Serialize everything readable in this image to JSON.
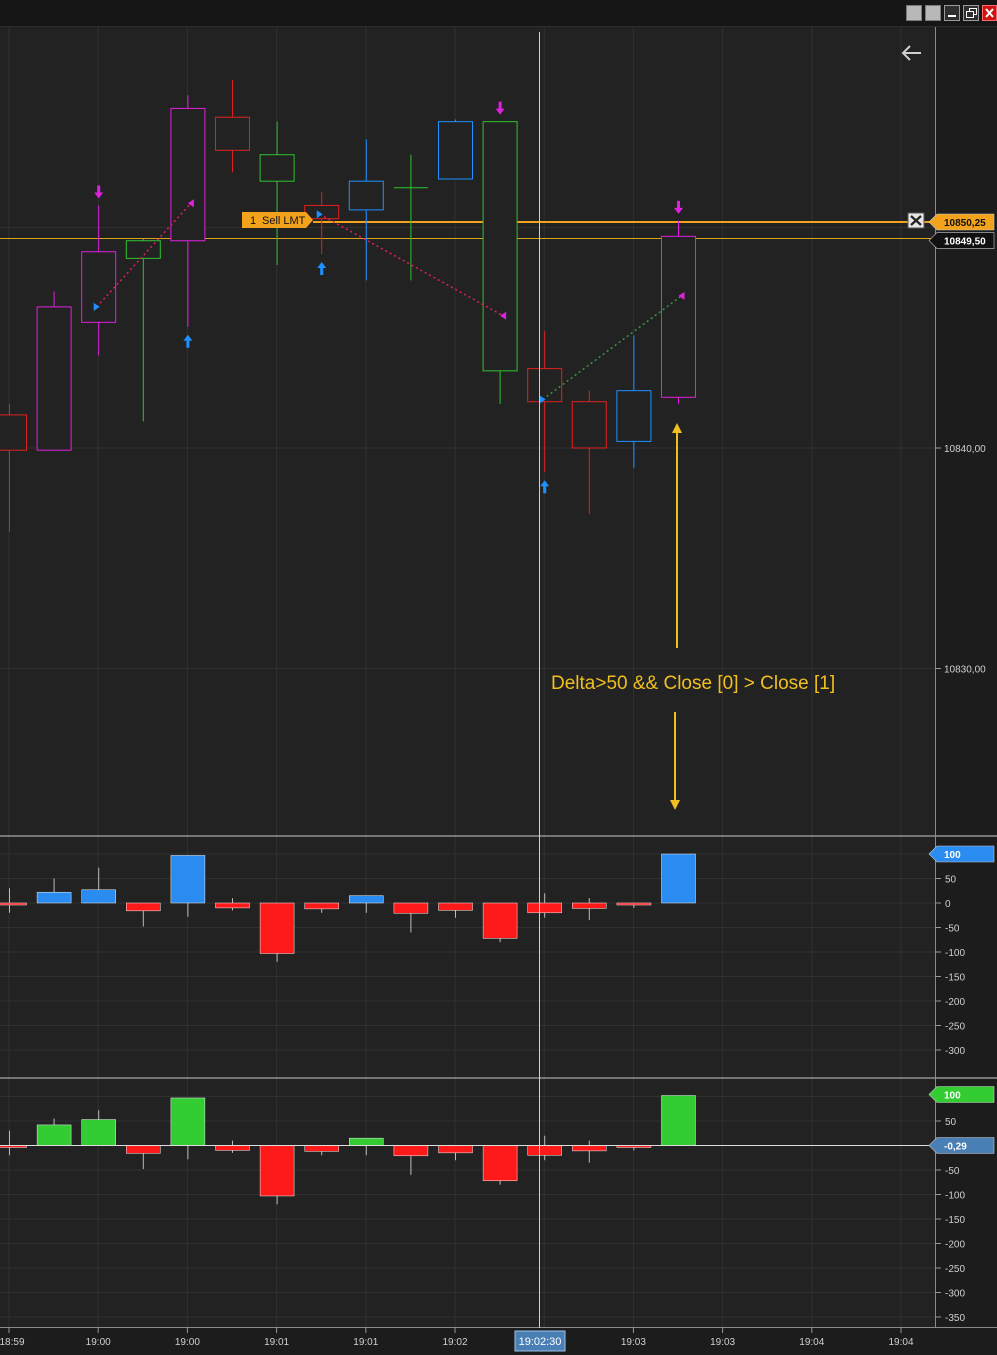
{
  "window_controls": [
    "restore-box-icon",
    "maximize-box-icon",
    "minimize-icon",
    "restore-icon",
    "close-icon"
  ],
  "colors": {
    "background": "#222222",
    "grid": "#303030",
    "up_candle": "#1e90ff",
    "down_candle": "#e02020",
    "doji_green": "#2ec32e",
    "magenta": "#e020e0",
    "order_line": "#f3a21c",
    "price_line": "#d9a41c",
    "annotation": "#f0c020",
    "delta_up": "#2a8cf0",
    "delta_down": "#ff1a1a",
    "cum_up": "#33cc33"
  },
  "order": {
    "qty": "1",
    "label": "Sell LMT",
    "price": 10850.25
  },
  "price_axis": {
    "ticks": [
      "10840,00",
      "10830,00"
    ],
    "order_price_label": "10850,25",
    "last_price_label": "10849,50"
  },
  "annotation": {
    "text": "Delta>50 && Close [0] > Close [1]"
  },
  "time_axis": {
    "labels": [
      "18:59",
      "19:00",
      "19:00",
      "19:01",
      "19:01",
      "19:02",
      "19:02:30",
      "19:03",
      "19:03",
      "19:04",
      "19:04"
    ],
    "crosshair_label": "19:02:30"
  },
  "chart_data": [
    {
      "type": "candlestick",
      "title": "",
      "ylim": [
        10822.5,
        10859
      ],
      "x_labels": [
        "18:59",
        "19:00",
        "19:00",
        "19:01",
        "19:01",
        "19:02",
        "19:02:30",
        "19:03",
        "19:03",
        "19:04",
        "19:04"
      ],
      "candles": [
        {
          "o": 10841.5,
          "h": 10842.0,
          "l": 10836.2,
          "c": 10839.9,
          "color": "red"
        },
        {
          "o": 10839.9,
          "h": 10847.1,
          "l": 10839.9,
          "c": 10846.4,
          "color": "magenta"
        },
        {
          "o": 10845.7,
          "h": 10851.0,
          "l": 10844.2,
          "c": 10848.9,
          "color": "magenta"
        },
        {
          "o": 10848.6,
          "h": 10849.5,
          "l": 10841.2,
          "c": 10849.4,
          "color": "green"
        },
        {
          "o": 10849.4,
          "h": 10856.0,
          "l": 10845.5,
          "c": 10855.4,
          "color": "magenta"
        },
        {
          "o": 10855.0,
          "h": 10856.7,
          "l": 10852.5,
          "c": 10853.5,
          "color": "red"
        },
        {
          "o": 10853.3,
          "h": 10854.8,
          "l": 10848.3,
          "c": 10852.1,
          "color": "green"
        },
        {
          "o": 10851.0,
          "h": 10851.6,
          "l": 10848.8,
          "c": 10850.4,
          "color": "red"
        },
        {
          "o": 10850.8,
          "h": 10854.0,
          "l": 10847.6,
          "c": 10852.1,
          "color": "blue"
        },
        {
          "o": 10851.8,
          "h": 10853.3,
          "l": 10847.6,
          "c": 10851.8,
          "color": "green"
        },
        {
          "o": 10852.2,
          "h": 10854.9,
          "l": 10852.2,
          "c": 10854.8,
          "color": "blue"
        },
        {
          "o": 10854.8,
          "h": 10854.8,
          "l": 10842.0,
          "c": 10843.5,
          "color": "green"
        },
        {
          "o": 10843.6,
          "h": 10845.3,
          "l": 10838.9,
          "c": 10842.1,
          "color": "red"
        },
        {
          "o": 10842.1,
          "h": 10842.6,
          "l": 10837.0,
          "c": 10840.0,
          "color": "red"
        },
        {
          "o": 10840.3,
          "h": 10845.1,
          "l": 10839.1,
          "c": 10842.6,
          "color": "blue"
        },
        {
          "o": 10842.3,
          "h": 10850.3,
          "l": 10842.0,
          "c": 10849.6,
          "color": "magenta"
        }
      ],
      "markers": [
        {
          "bar": 2,
          "type": "down",
          "color": "magenta"
        },
        {
          "bar": 4,
          "type": "up",
          "color": "blue"
        },
        {
          "bar": 7,
          "type": "up",
          "color": "blue"
        },
        {
          "bar": 11,
          "type": "down",
          "color": "magenta"
        },
        {
          "bar": 12,
          "type": "up",
          "color": "blue"
        },
        {
          "bar": 15,
          "type": "down",
          "color": "magenta"
        }
      ],
      "trades": [
        {
          "from_bar": 2,
          "from_price": 10846.4,
          "to_bar": 4,
          "to_price": 10851.1,
          "color": "#e02060"
        },
        {
          "from_bar": 7,
          "from_price": 10850.6,
          "to_bar": 11,
          "to_price": 10846.0,
          "color": "#e02060"
        },
        {
          "from_bar": 12,
          "from_price": 10842.2,
          "to_bar": 15,
          "to_price": 10846.9,
          "color": "#2ea043"
        }
      ]
    },
    {
      "type": "bar",
      "title": "",
      "ylim": [
        -320,
        110
      ],
      "ticks": [
        100,
        50,
        0,
        -50,
        -100,
        -150,
        -200,
        -250,
        -300
      ],
      "last_value_label": "100",
      "values": [
        -3,
        22,
        27,
        -16,
        97,
        -10,
        -103,
        -12,
        15,
        -21,
        -15,
        -72,
        -20,
        -11,
        -4,
        100
      ],
      "wick_high": [
        30,
        50,
        72,
        0,
        97,
        10,
        0,
        0,
        15,
        0,
        0,
        0,
        20,
        10,
        0,
        100
      ],
      "wick_low": [
        -20,
        0,
        0,
        -48,
        -28,
        -15,
        -120,
        -20,
        -20,
        -60,
        -30,
        -80,
        -30,
        -35,
        -10,
        0
      ]
    },
    {
      "type": "bar",
      "title": "",
      "ylim": [
        -360,
        110
      ],
      "ticks": [
        100,
        50,
        -50,
        -100,
        -150,
        -200,
        -250,
        -300,
        -350
      ],
      "last_value_label": "100",
      "current_value_label": "-0,29",
      "values": [
        -3,
        42,
        53,
        -16,
        97,
        -10,
        -103,
        -12,
        15,
        -21,
        -15,
        -72,
        -20,
        -11,
        -4,
        102
      ],
      "wick_high": [
        30,
        55,
        72,
        0,
        97,
        10,
        0,
        0,
        15,
        0,
        0,
        0,
        20,
        10,
        0,
        102
      ],
      "wick_low": [
        -20,
        0,
        0,
        -48,
        -28,
        -15,
        -120,
        -20,
        -20,
        -60,
        -30,
        -80,
        -30,
        -35,
        -10,
        0
      ]
    }
  ]
}
